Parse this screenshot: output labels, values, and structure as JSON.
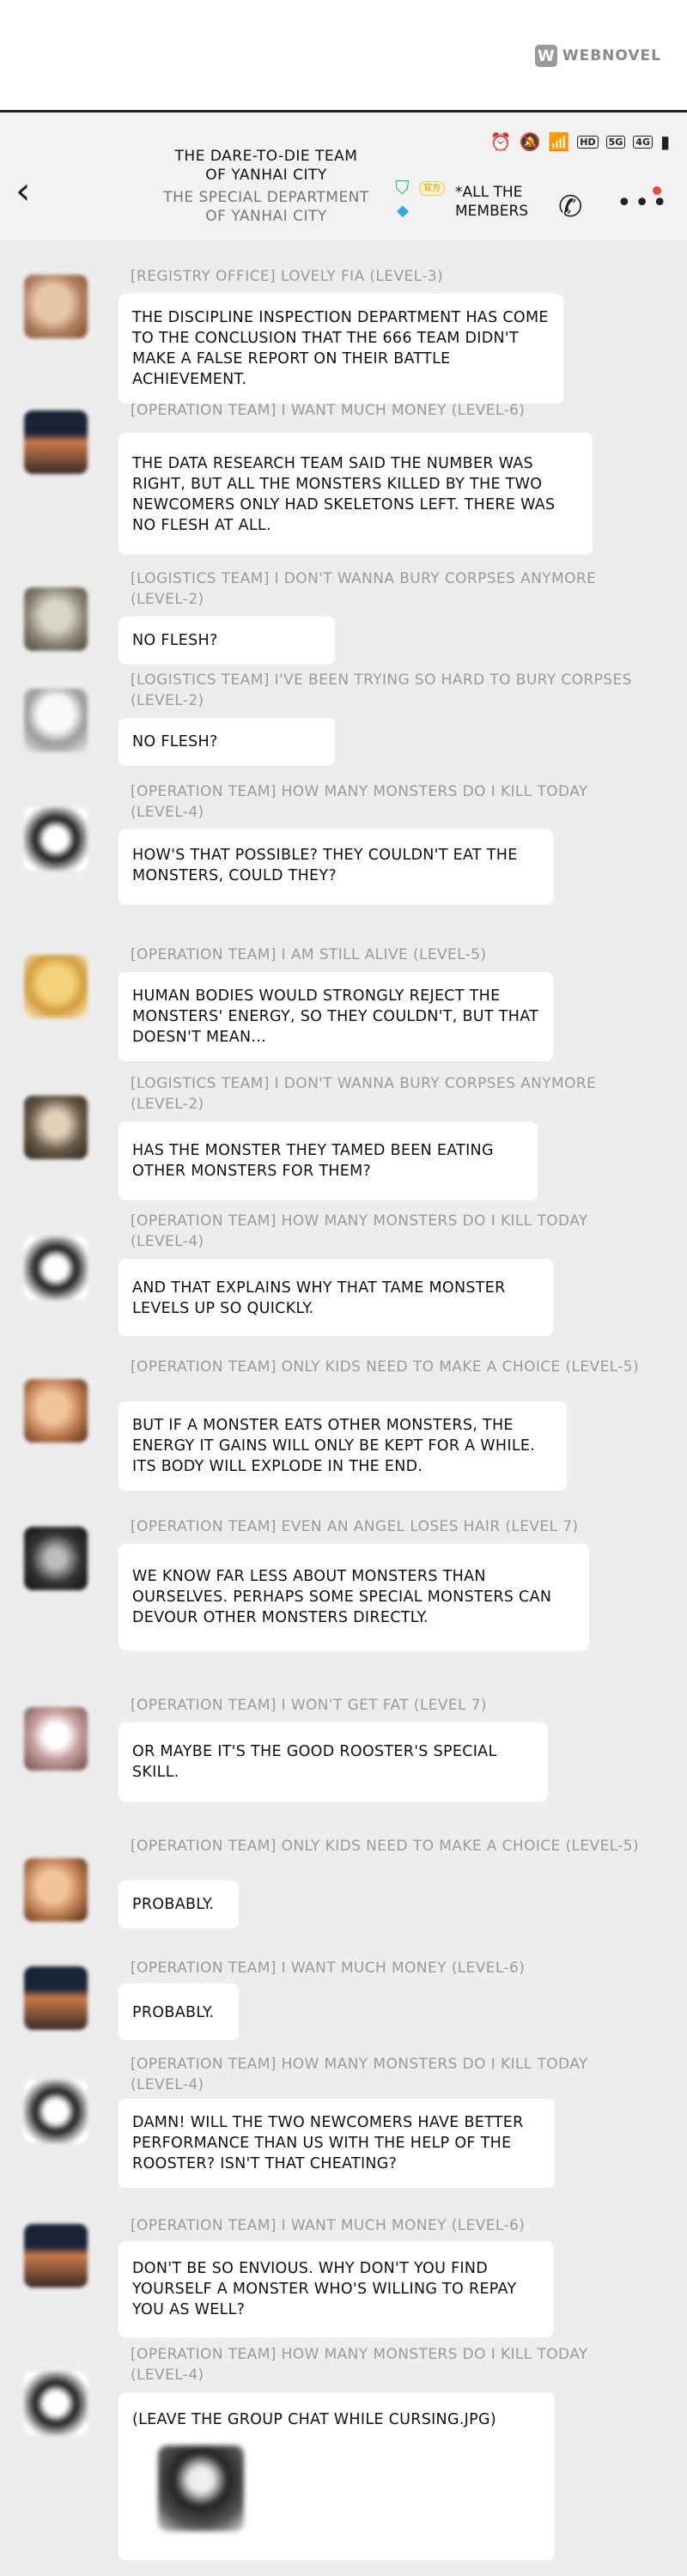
{
  "watermark": {
    "logo": "W",
    "text": "WEBNOVEL"
  },
  "status_bar": {
    "alarm_icon": "⏰",
    "mute_icon": "🔕",
    "wifi_icon": "📶",
    "hd_label": "HD",
    "sig1": "5G",
    "sig2": "4G",
    "battery_icon": "▮"
  },
  "header": {
    "back_label": "‹",
    "title": "THE DARE-TO-DIE TEAM OF YANHAI CITY",
    "subtitle": "THE SPECIAL DEPARTMENT OF YANHAI CITY",
    "badge_chip": "官方",
    "members_label": "*ALL THE MEMBERS",
    "call_icon": "✆",
    "more_icon": "•••"
  },
  "messages": [
    {
      "sender": "[REGISTRY OFFICE] LOVELY FIA (LEVEL-3)",
      "text": "THE DISCIPLINE INSPECTION DEPARTMENT HAS COME TO THE CONCLUSION THAT THE 666 TEAM DIDN'T MAKE A FALSE REPORT ON THEIR BATTLE ACHIEVEMENT."
    },
    {
      "sender": "[OPERATION TEAM] I WANT MUCH MONEY (LEVEL-6)",
      "text": "THE DATA RESEARCH TEAM SAID THE NUMBER WAS RIGHT, BUT ALL THE MONSTERS KILLED BY THE TWO NEWCOMERS ONLY HAD SKELETONS LEFT. THERE WAS NO FLESH AT ALL."
    },
    {
      "sender": "[LOGISTICS TEAM] I DON'T WANNA BURY CORPSES ANYMORE (LEVEL-2)",
      "text": "NO FLESH?"
    },
    {
      "sender": "[LOGISTICS TEAM] I'VE BEEN TRYING SO HARD TO BURY CORPSES (LEVEL-2)",
      "text": "NO FLESH?"
    },
    {
      "sender": "[OPERATION TEAM] HOW MANY MONSTERS DO I KILL TODAY (LEVEL-4)",
      "text": "HOW'S THAT POSSIBLE? THEY COULDN'T EAT THE MONSTERS, COULD THEY?"
    },
    {
      "sender": "[OPERATION TEAM] I AM STILL ALIVE (LEVEL-5)",
      "text": "HUMAN BODIES WOULD STRONGLY REJECT THE MONSTERS' ENERGY, SO THEY COULDN'T, BUT THAT DOESN'T MEAN..."
    },
    {
      "sender": "[LOGISTICS TEAM] I DON'T WANNA BURY CORPSES ANYMORE (LEVEL-2)",
      "text": "HAS THE MONSTER THEY TAMED BEEN EATING OTHER MONSTERS FOR THEM?"
    },
    {
      "sender": "[OPERATION TEAM] HOW MANY MONSTERS DO I KILL TODAY (LEVEL-4)",
      "text": "AND THAT EXPLAINS WHY THAT TAME MONSTER LEVELS UP SO QUICKLY."
    },
    {
      "sender": "[OPERATION TEAM] ONLY KIDS NEED TO MAKE A CHOICE (LEVEL-5)",
      "text": "BUT IF A MONSTER EATS OTHER MONSTERS, THE ENERGY IT GAINS WILL ONLY BE KEPT FOR A WHILE. ITS BODY WILL EXPLODE IN THE END."
    },
    {
      "sender": "[OPERATION TEAM] EVEN AN ANGEL LOSES HAIR (LEVEL 7)",
      "text": "WE KNOW FAR LESS ABOUT MONSTERS THAN OURSELVES. PERHAPS SOME SPECIAL MONSTERS CAN DEVOUR OTHER MONSTERS DIRECTLY."
    },
    {
      "sender": "[OPERATION TEAM] I WON'T GET FAT (LEVEL 7)",
      "text": "OR MAYBE IT'S THE GOOD ROOSTER'S SPECIAL SKILL."
    },
    {
      "sender": "[OPERATION TEAM] ONLY KIDS NEED TO MAKE A CHOICE (LEVEL-5)",
      "text": "PROBABLY."
    },
    {
      "sender": "[OPERATION TEAM] I WANT MUCH MONEY (LEVEL-6)",
      "text": "PROBABLY."
    },
    {
      "sender": "[OPERATION TEAM] HOW MANY MONSTERS DO I KILL TODAY (LEVEL-4)",
      "text": "DAMN! WILL THE TWO NEWCOMERS HAVE BETTER PERFORMANCE THAN US WITH THE HELP OF THE ROOSTER? ISN'T THAT CHEATING?"
    },
    {
      "sender": "[OPERATION TEAM] I WANT MUCH MONEY (LEVEL-6)",
      "text": "DON'T BE SO ENVIOUS. WHY DON'T YOU FIND YOURSELF A MONSTER WHO'S WILLING TO REPAY YOU AS WELL?"
    },
    {
      "sender": "[OPERATION TEAM] HOW MANY MONSTERS DO I KILL TODAY (LEVEL-4)",
      "text": "(LEAVE THE GROUP CHAT WHILE CURSING.JPG)"
    }
  ]
}
